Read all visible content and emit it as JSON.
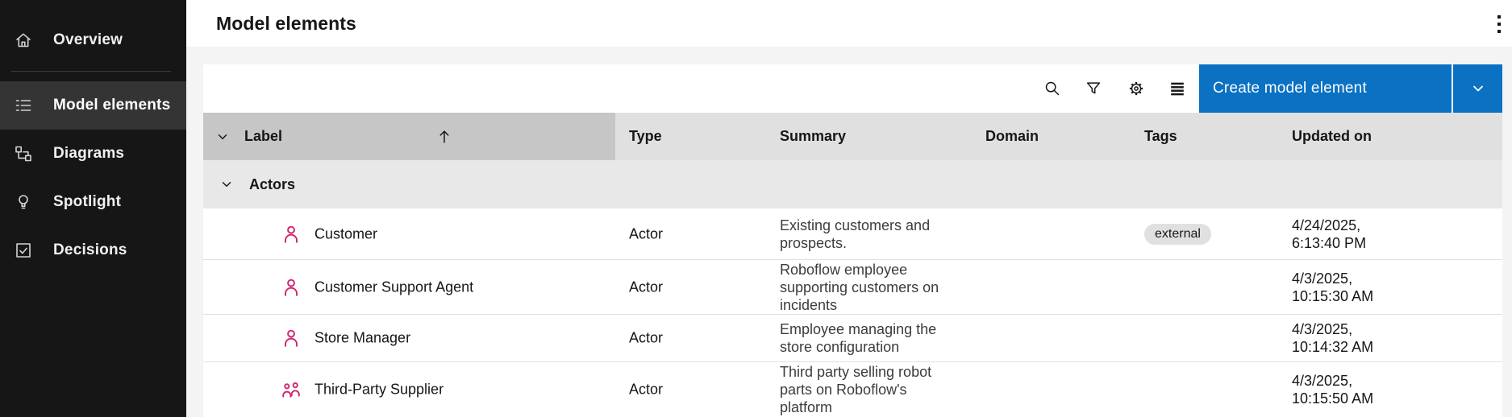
{
  "app": {
    "accent_blue": "#0a71c3",
    "magenta": "#d02670"
  },
  "titlebar": {
    "title": "Model elements",
    "kebab_icon": "overflow-menu-vertical-icon"
  },
  "sidebar": {
    "items": [
      {
        "label": "Overview",
        "icon": "home-icon",
        "selected": false
      },
      {
        "label": "Model elements",
        "icon": "list-icon",
        "selected": true
      },
      {
        "label": "Diagrams",
        "icon": "diagram-icon",
        "selected": false
      },
      {
        "label": "Spotlight",
        "icon": "lightbulb-icon",
        "selected": false
      },
      {
        "label": "Decisions",
        "icon": "checkbox-icon",
        "selected": false
      }
    ]
  },
  "toolbar": {
    "icons": [
      "search-icon",
      "filter-icon",
      "settings-icon",
      "rows-icon"
    ],
    "create_button_label": "Create model element"
  },
  "table": {
    "headers": {
      "label": "Label",
      "type": "Type",
      "summary": "Summary",
      "domain": "Domain",
      "tags": "Tags",
      "updated": "Updated on"
    },
    "sort": {
      "column": "Label",
      "direction": "ascending"
    },
    "group": {
      "name": "Actors",
      "expanded": true
    },
    "rows": [
      {
        "icon": "person-icon",
        "label": "Customer",
        "type": "Actor",
        "summary": "Existing customers and prospects.",
        "domain": "",
        "tag": "external",
        "updated": "4/24/2025, 6:13:40 PM"
      },
      {
        "icon": "person-icon",
        "label": "Customer Support Agent",
        "type": "Actor",
        "summary": "Roboflow employee supporting customers on incidents",
        "domain": "",
        "tag": "",
        "updated": "4/3/2025, 10:15:30 AM"
      },
      {
        "icon": "person-icon",
        "label": "Store Manager",
        "type": "Actor",
        "summary": "Employee managing the store configuration",
        "domain": "",
        "tag": "",
        "updated": "4/3/2025, 10:14:32 AM"
      },
      {
        "icon": "people-icon",
        "label": "Third-Party Supplier",
        "type": "Actor",
        "summary": "Third party selling robot parts on Roboflow's platform",
        "domain": "",
        "tag": "",
        "updated": "4/3/2025, 10:15:50 AM"
      }
    ]
  }
}
